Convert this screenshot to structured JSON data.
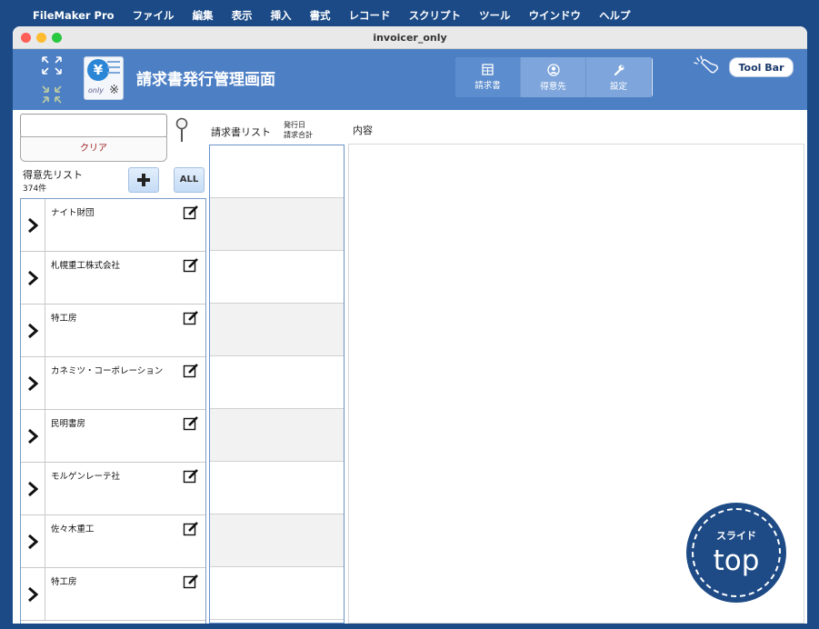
{
  "menubar": {
    "app_name": "FileMaker Pro",
    "items": [
      "ファイル",
      "編集",
      "表示",
      "挿入",
      "書式",
      "レコード",
      "スクリプト",
      "ツール",
      "ウインドウ",
      "ヘルプ"
    ]
  },
  "window": {
    "title": "invoicer_only"
  },
  "header": {
    "title": "請求書発行管理画面",
    "logo_text": "only",
    "tabs": [
      {
        "label": "請求書",
        "icon": "table-icon",
        "active": true
      },
      {
        "label": "得意先",
        "icon": "person-icon",
        "active": false
      },
      {
        "label": "設定",
        "icon": "wrench-icon",
        "active": false
      }
    ],
    "toolbar_label": "Tool Bar"
  },
  "left": {
    "search_value": "",
    "clear_label": "クリア",
    "list_title": "得意先リスト",
    "count": "374件",
    "add_label": "+",
    "all_label": "ALL",
    "customers": [
      "ナイト財団",
      "札幌重工株式会社",
      "特工房",
      "カネミツ・コーポレーション",
      "民明書房",
      "モルゲンレーテ社",
      "佐々木重工",
      "特工房"
    ]
  },
  "middle": {
    "title": "請求書リスト",
    "sub_label_1": "発行日",
    "sub_label_2": "請求合計"
  },
  "right": {
    "title": "内容"
  },
  "badge": {
    "small": "スライド",
    "big": "top"
  },
  "colors": {
    "header": "#4d7fc5",
    "page_bg": "#1b4a86",
    "badge": "#1e4b86"
  }
}
